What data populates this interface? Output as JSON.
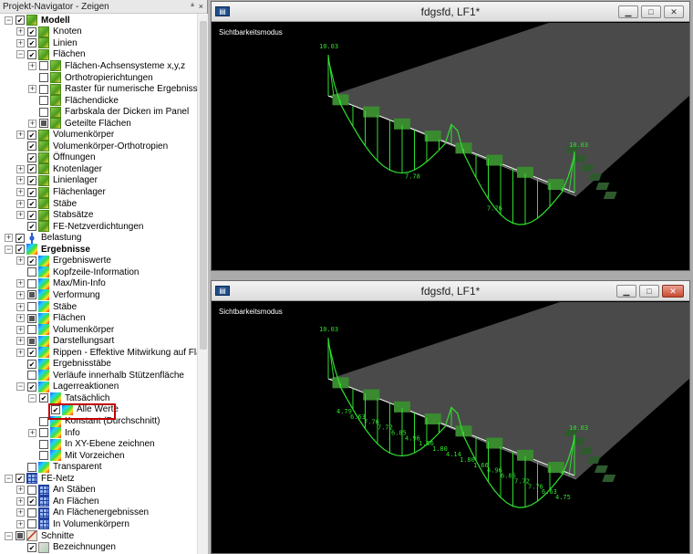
{
  "navigator": {
    "title": "Projekt-Navigator - Zeigen",
    "pin_glyph": "ª",
    "close_glyph": "×",
    "highlight_color": "#c00000",
    "rows": [
      {
        "level": 0,
        "exp": "-",
        "cb": "checked",
        "icon": "model",
        "label": "Modell",
        "bold": true
      },
      {
        "level": 1,
        "exp": "+",
        "cb": "checked",
        "icon": "model",
        "label": "Knoten"
      },
      {
        "level": 1,
        "exp": "+",
        "cb": "checked",
        "icon": "model",
        "label": "Linien"
      },
      {
        "level": 1,
        "exp": "-",
        "cb": "checked",
        "icon": "model",
        "label": "Flächen"
      },
      {
        "level": 2,
        "exp": "+",
        "cb": "empty",
        "icon": "model",
        "label": "Flächen-Achsensysteme x,y,z"
      },
      {
        "level": 2,
        "exp": "",
        "cb": "empty",
        "icon": "model",
        "label": "Orthotropierichtungen"
      },
      {
        "level": 2,
        "exp": "+",
        "cb": "empty",
        "icon": "model",
        "label": "Raster für numerische Ergebnisse"
      },
      {
        "level": 2,
        "exp": "",
        "cb": "empty",
        "icon": "model",
        "label": "Flächendicke"
      },
      {
        "level": 2,
        "exp": "",
        "cb": "empty",
        "icon": "model",
        "label": "Farbskala der Dicken im Panel"
      },
      {
        "level": 2,
        "exp": "+",
        "cb": "partial",
        "icon": "model",
        "label": "Geteilte Flächen"
      },
      {
        "level": 1,
        "exp": "+",
        "cb": "checked",
        "icon": "model",
        "label": "Volumenkörper"
      },
      {
        "level": 1,
        "exp": "",
        "cb": "checked",
        "icon": "model",
        "label": "Volumenkörper-Orthotropien"
      },
      {
        "level": 1,
        "exp": "",
        "cb": "checked",
        "icon": "model",
        "label": "Öffnungen"
      },
      {
        "level": 1,
        "exp": "+",
        "cb": "checked",
        "icon": "model",
        "label": "Knotenlager"
      },
      {
        "level": 1,
        "exp": "+",
        "cb": "checked",
        "icon": "model",
        "label": "Linienlager"
      },
      {
        "level": 1,
        "exp": "+",
        "cb": "checked",
        "icon": "model",
        "label": "Flächenlager"
      },
      {
        "level": 1,
        "exp": "+",
        "cb": "checked",
        "icon": "model",
        "label": "Stäbe"
      },
      {
        "level": 1,
        "exp": "+",
        "cb": "checked",
        "icon": "model",
        "label": "Stabsätze"
      },
      {
        "level": 1,
        "exp": "",
        "cb": "checked",
        "icon": "model",
        "label": "FE-Netzverdichtungen"
      },
      {
        "level": 0,
        "exp": "+",
        "cb": "checked",
        "icon": "load",
        "label": "Belastung"
      },
      {
        "level": 0,
        "exp": "-",
        "cb": "checked",
        "icon": "result",
        "label": "Ergebnisse",
        "bold": true
      },
      {
        "level": 1,
        "exp": "+",
        "cb": "checked",
        "icon": "result",
        "label": "Ergebniswerte"
      },
      {
        "level": 1,
        "exp": "",
        "cb": "empty",
        "icon": "result",
        "label": "Kopfzeile-Information"
      },
      {
        "level": 1,
        "exp": "+",
        "cb": "empty",
        "icon": "result",
        "label": "Max/Min-Info"
      },
      {
        "level": 1,
        "exp": "+",
        "cb": "partial",
        "icon": "result",
        "label": "Verformung"
      },
      {
        "level": 1,
        "exp": "+",
        "cb": "empty",
        "icon": "result",
        "label": "Stäbe"
      },
      {
        "level": 1,
        "exp": "+",
        "cb": "partial",
        "icon": "result",
        "label": "Flächen"
      },
      {
        "level": 1,
        "exp": "+",
        "cb": "empty",
        "icon": "result",
        "label": "Volumenkörper"
      },
      {
        "level": 1,
        "exp": "+",
        "cb": "partial",
        "icon": "result",
        "label": "Darstellungsart"
      },
      {
        "level": 1,
        "exp": "+",
        "cb": "checked",
        "icon": "result",
        "label": "Rippen - Effektive Mitwirkung auf Fläche/Stäbe"
      },
      {
        "level": 1,
        "exp": "",
        "cb": "checked",
        "icon": "result",
        "label": "Ergebnisstäbe"
      },
      {
        "level": 1,
        "exp": "",
        "cb": "empty",
        "icon": "result",
        "label": "Verläufe innerhalb Stützenfläche"
      },
      {
        "level": 1,
        "exp": "-",
        "cb": "checked",
        "icon": "result",
        "label": "Lagerreaktionen"
      },
      {
        "level": 2,
        "exp": "-",
        "cb": "checked",
        "icon": "result",
        "label": "Tatsächlich"
      },
      {
        "level": 3,
        "exp": "",
        "cb": "checked",
        "icon": "result",
        "label": "Alle Werte"
      },
      {
        "level": 2,
        "exp": "",
        "cb": "empty",
        "icon": "result",
        "label": "Konstant (Durchschnitt)"
      },
      {
        "level": 2,
        "exp": "+",
        "cb": "empty",
        "icon": "result",
        "label": "Info"
      },
      {
        "level": 2,
        "exp": "",
        "cb": "empty",
        "icon": "result",
        "label": "In XY-Ebene zeichnen"
      },
      {
        "level": 2,
        "exp": "",
        "cb": "empty",
        "icon": "result",
        "label": "Mit Vorzeichen"
      },
      {
        "level": 1,
        "exp": "",
        "cb": "empty",
        "icon": "result",
        "label": "Transparent"
      },
      {
        "level": 0,
        "exp": "-",
        "cb": "checked",
        "icon": "mesh",
        "label": "FE-Netz"
      },
      {
        "level": 1,
        "exp": "+",
        "cb": "empty",
        "icon": "mesh",
        "label": "An Stäben"
      },
      {
        "level": 1,
        "exp": "+",
        "cb": "checked",
        "icon": "mesh",
        "label": "An Flächen"
      },
      {
        "level": 1,
        "exp": "+",
        "cb": "empty",
        "icon": "mesh",
        "label": "An Flächenergebnissen"
      },
      {
        "level": 1,
        "exp": "+",
        "cb": "empty",
        "icon": "mesh",
        "label": "In Volumenkörpern"
      },
      {
        "level": 0,
        "exp": "-",
        "cb": "partial",
        "icon": "cut",
        "label": "Schnitte"
      },
      {
        "level": 1,
        "exp": "",
        "cb": "checked",
        "icon": "label",
        "label": "Bezeichnungen"
      }
    ]
  },
  "windows": [
    {
      "title": "fdgsfd, LF1*",
      "mode_label": "Sichtbarkeitsmodus",
      "values": [
        "10.03",
        "7.78",
        "7.76",
        "10.03"
      ]
    },
    {
      "title": "fdgsfd, LF1*",
      "mode_label": "Sichtbarkeitsmodus",
      "values": [
        "10.03",
        "4.79",
        "6.63",
        "7.76",
        "7.72",
        "6.85",
        "4.96",
        "1.66",
        "1.80",
        "4.14",
        "1.80",
        "1.66",
        "4.96",
        "6.85",
        "7.72",
        "7.76",
        "6.63",
        "4.75",
        "10.03"
      ]
    }
  ],
  "window_buttons": {
    "min": "▁",
    "max": "□",
    "close": "✕"
  },
  "colors": {
    "diagram": "#30e030",
    "slab": "#4a4a4a",
    "support": "#2e5a2e"
  }
}
